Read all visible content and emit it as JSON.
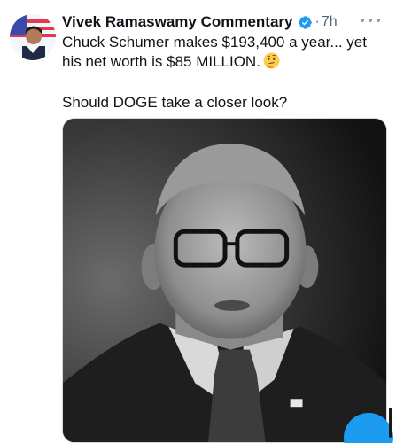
{
  "author": {
    "name": "Vivek Ramaswamy Commentary",
    "separator": "·",
    "time": "7h"
  },
  "post": {
    "line1": "Chuck Schumer makes $193,400 a year... yet his net worth is $85 MILLION.",
    "line2": "Should DOGE take a closer look?"
  },
  "colors": {
    "verified_badge": "#1d9bf0",
    "floating_button": "#1d9bf0",
    "secondary_text": "#536471"
  },
  "icons": {
    "verified": "verified-badge-icon",
    "emoji": "thinking-face-emoji-icon",
    "more": "more-options-icon"
  }
}
